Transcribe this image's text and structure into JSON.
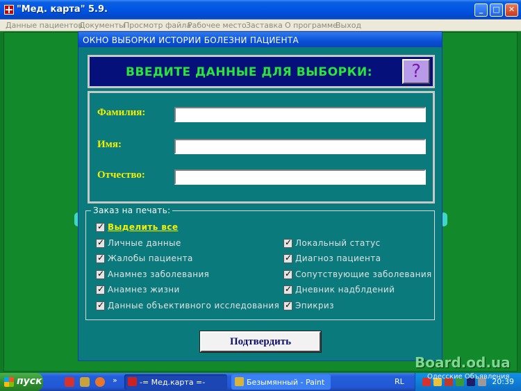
{
  "app": {
    "title": "\"Мед. карта\" 5.9.",
    "minimize": "_",
    "maximize": "□",
    "close": "✕"
  },
  "menu": [
    "Данные пациентов",
    "Документы",
    "Просмотр файла",
    "Рабочее место",
    "Заставка",
    "О программе",
    "Выход"
  ],
  "dialog": {
    "title": "ОКНО  ВЫБОРКИ  ИСТОРИИ  БОЛЕЗНИ  ПАЦИЕНТА",
    "prompt": "ВВЕДИТЕ ДАННЫЕ ДЛЯ ВЫБОРКИ:",
    "help": "?",
    "fields": [
      {
        "label": "Фамилия:",
        "value": ""
      },
      {
        "label": "Имя:",
        "value": ""
      },
      {
        "label": "Отчество:",
        "value": ""
      }
    ],
    "print_group_label": "Заказ  на  печать:",
    "select_all": {
      "label": "Выделить  все",
      "checked": true
    },
    "left_items": [
      {
        "label": "Личные  данные",
        "checked": true
      },
      {
        "label": "Жалобы  пациента",
        "checked": true
      },
      {
        "label": "Анамнез  заболевания",
        "checked": true
      },
      {
        "label": "Анамнез  жизни",
        "checked": true
      },
      {
        "label": "Данные  объективного  исследования",
        "checked": true
      }
    ],
    "right_items": [
      {
        "label": "Локальный  статус",
        "checked": true
      },
      {
        "label": "Диагноз  пациента",
        "checked": true
      },
      {
        "label": "Сопутствующие  заболевания",
        "checked": true
      },
      {
        "label": "Дневник  надблдений",
        "checked": true
      },
      {
        "label": "Эпикриз",
        "checked": true
      }
    ],
    "confirm": "Подтвердить"
  },
  "taskbar": {
    "start": "пуск",
    "more": "»",
    "tasks": [
      "-= Мед.карта =-",
      "Безымянный - Paint"
    ],
    "lang": "RL",
    "clock": "20:39",
    "popup": "Одесские  Объявления"
  },
  "watermark": "Board.od.ua",
  "colors": {
    "desktop": "#0a6b1f",
    "dialog": "#0a7a7c",
    "prompt_bg": "#05107a",
    "prompt_text": "#28e63a",
    "field_label": "#f4f000"
  }
}
